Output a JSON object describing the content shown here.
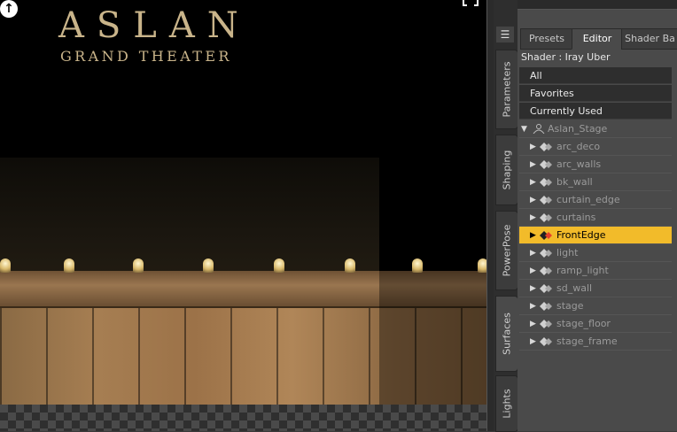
{
  "viewport": {
    "logo_title": "ASLAN",
    "logo_subtitle": "GRAND THEATER"
  },
  "side_tabs": [
    {
      "label": "Parameters"
    },
    {
      "label": "Shaping"
    },
    {
      "label": "PowerPose"
    },
    {
      "label": "Surfaces",
      "active": true
    },
    {
      "label": "Lights"
    }
  ],
  "panel": {
    "tabs": [
      {
        "label": "Presets"
      },
      {
        "label": "Editor",
        "active": true
      },
      {
        "label": "Shader Ba"
      }
    ],
    "shader_label": "Shader : Iray Uber",
    "filters": [
      "All",
      "Favorites",
      "Currently Used"
    ],
    "tree": {
      "root": "Aslan_Stage",
      "items": [
        "arc_deco",
        "arc_walls",
        "bk_wall",
        "curtain_edge",
        "curtains",
        "FrontEdge",
        "light",
        "ramp_light",
        "sd_wall",
        "stage",
        "stage_floor",
        "stage_frame"
      ],
      "selected": "FrontEdge"
    }
  },
  "colors": {
    "selection": "#f2bb2a",
    "panel_bg": "#4a4a4a"
  },
  "icons": {
    "root": "figure-icon",
    "item": "surface-material-icon",
    "expand": "triangle-right-icon",
    "collapse": "triangle-down-icon"
  }
}
